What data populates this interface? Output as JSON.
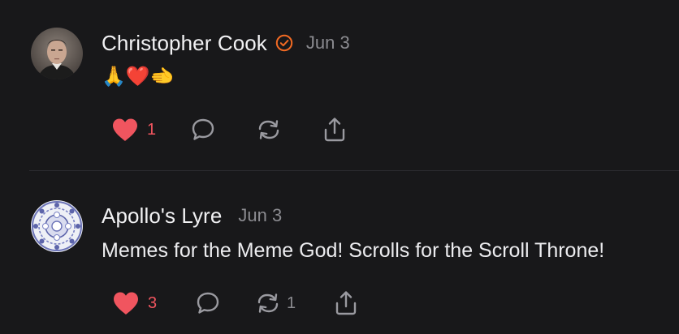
{
  "posts": [
    {
      "author": "Christopher Cook",
      "verified": true,
      "date": "Jun 3",
      "text": "🙏❤️🫲",
      "likes": "1",
      "restacks": ""
    },
    {
      "author": "Apollo's Lyre",
      "verified": false,
      "date": "Jun 3",
      "text": "Memes for the Meme God! Scrolls for the Scroll Throne!",
      "likes": "3",
      "restacks": "1"
    }
  ],
  "icons": {
    "like": "heart-icon",
    "comment": "comment-icon",
    "restack": "restack-icon",
    "share": "share-icon",
    "verified": "verified-badge-icon"
  },
  "colors": {
    "background": "#18181a",
    "like": "#f0555f",
    "verified": "#f26a23",
    "muted": "#8b8b90"
  }
}
